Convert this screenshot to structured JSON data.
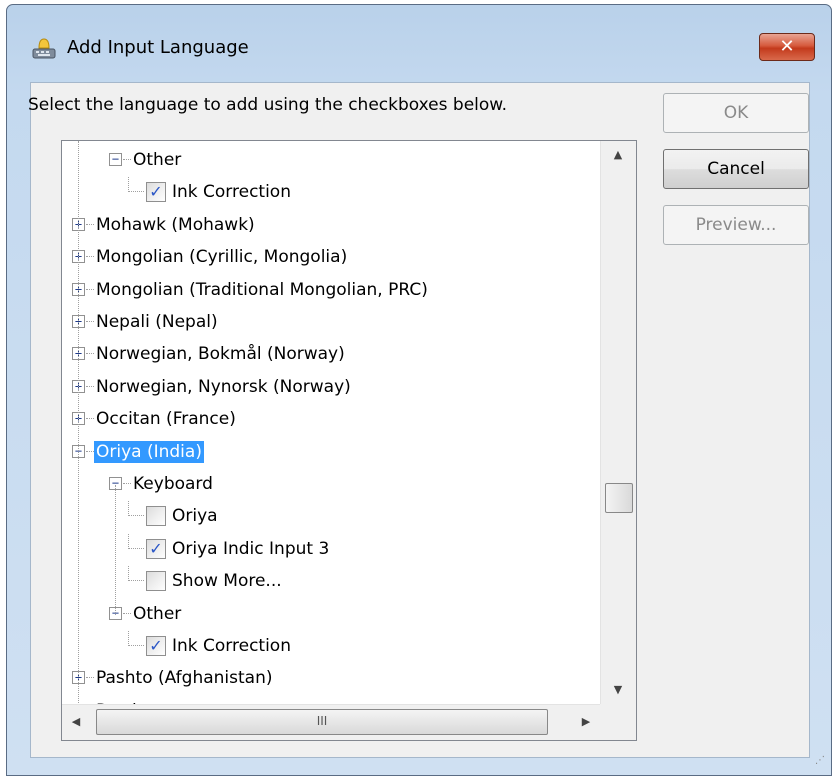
{
  "window": {
    "title": "Add Input Language",
    "close_label": "✕"
  },
  "instruction": "Select the language to add using the checkboxes below.",
  "buttons": {
    "ok": "OK",
    "cancel": "Cancel",
    "preview": "Preview..."
  },
  "tree": {
    "items": [
      {
        "level": 1,
        "type": "expanded",
        "label": "Other"
      },
      {
        "level": 2,
        "type": "check",
        "checked": true,
        "label": "Ink Correction"
      },
      {
        "level": 0,
        "type": "collapsed",
        "label": "Mohawk (Mohawk)"
      },
      {
        "level": 0,
        "type": "collapsed",
        "label": "Mongolian (Cyrillic, Mongolia)"
      },
      {
        "level": 0,
        "type": "collapsed",
        "label": "Mongolian (Traditional Mongolian, PRC)"
      },
      {
        "level": 0,
        "type": "collapsed",
        "label": "Nepali (Nepal)"
      },
      {
        "level": 0,
        "type": "collapsed",
        "label": "Norwegian, Bokmål (Norway)"
      },
      {
        "level": 0,
        "type": "collapsed",
        "label": "Norwegian, Nynorsk (Norway)"
      },
      {
        "level": 0,
        "type": "collapsed",
        "label": "Occitan (France)"
      },
      {
        "level": 0,
        "type": "expanded",
        "label": "Oriya (India)",
        "selected": true
      },
      {
        "level": 1,
        "type": "expanded",
        "label": "Keyboard"
      },
      {
        "level": 2,
        "type": "check",
        "checked": false,
        "label": "Oriya"
      },
      {
        "level": 2,
        "type": "check",
        "checked": true,
        "label": "Oriya Indic Input 3"
      },
      {
        "level": 2,
        "type": "check",
        "checked": false,
        "label": "Show More..."
      },
      {
        "level": 1,
        "type": "expanded",
        "label": "Other"
      },
      {
        "level": 2,
        "type": "check",
        "checked": true,
        "label": "Ink Correction"
      },
      {
        "level": 0,
        "type": "collapsed",
        "label": "Pashto (Afghanistan)"
      },
      {
        "level": 0,
        "type": "collapsed",
        "label": "Persian"
      }
    ]
  },
  "scrollbar": {
    "hscroll_grip": "III"
  },
  "colors": {
    "selection": "#3399ff",
    "close_button": "#c9432a",
    "window_frame": "#b9d1ea"
  }
}
